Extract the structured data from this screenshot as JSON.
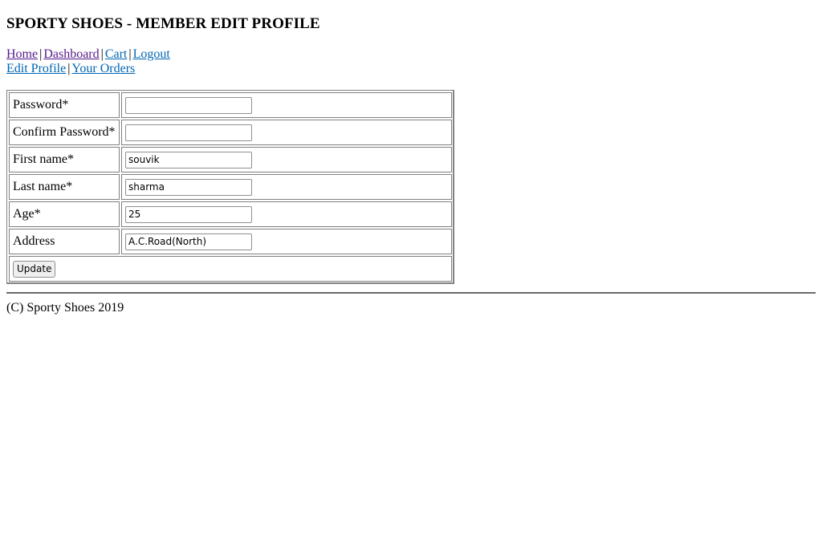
{
  "header": {
    "title": "SPORTY SHOES - MEMBER EDIT PROFILE"
  },
  "nav": {
    "row1": [
      {
        "label": "Home",
        "visited": true
      },
      {
        "label": "Dashboard",
        "visited": true
      },
      {
        "label": "Cart",
        "visited": false
      },
      {
        "label": "Logout",
        "visited": false
      }
    ],
    "row2": [
      {
        "label": "Edit Profile",
        "visited": false
      },
      {
        "label": "Your Orders",
        "visited": false
      }
    ],
    "separator": "|"
  },
  "form": {
    "fields": [
      {
        "label": "Password*",
        "value": "",
        "type": "password"
      },
      {
        "label": "Confirm Password*",
        "value": "",
        "type": "password"
      },
      {
        "label": "First name*",
        "value": "souvik",
        "type": "text"
      },
      {
        "label": "Last name*",
        "value": "sharma",
        "type": "text"
      },
      {
        "label": "Age*",
        "value": "25",
        "type": "text"
      },
      {
        "label": "Address",
        "value": "A.C.Road(North)",
        "type": "text"
      }
    ],
    "submit_label": "Update"
  },
  "footer": {
    "text": "(C) Sporty Shoes 2019"
  },
  "colors": {
    "link": "#0066b3",
    "link_visited": "#551a8b",
    "border": "#808080"
  }
}
